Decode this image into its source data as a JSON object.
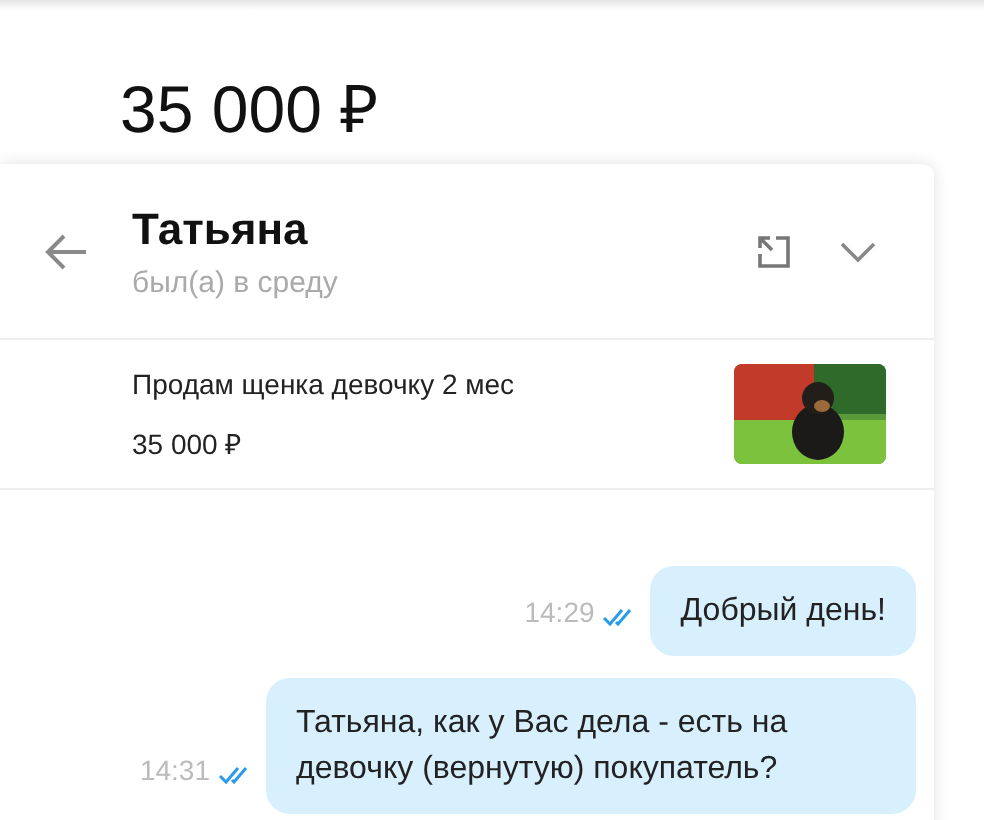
{
  "price": "35 000 ₽",
  "chat": {
    "name": "Татьяна",
    "status": "был(а) в среду",
    "listing": {
      "title": "Продам щенка девочку 2 мес",
      "price": "35 000 ₽",
      "kind": "picture"
    },
    "messages": [
      {
        "time": "14:29",
        "read": true,
        "text": "Добрый день!"
      },
      {
        "time": "14:31",
        "read": true,
        "text": "Татьяна, как у Вас дела - есть на девочку  (вернутую) покупатель?"
      }
    ]
  }
}
